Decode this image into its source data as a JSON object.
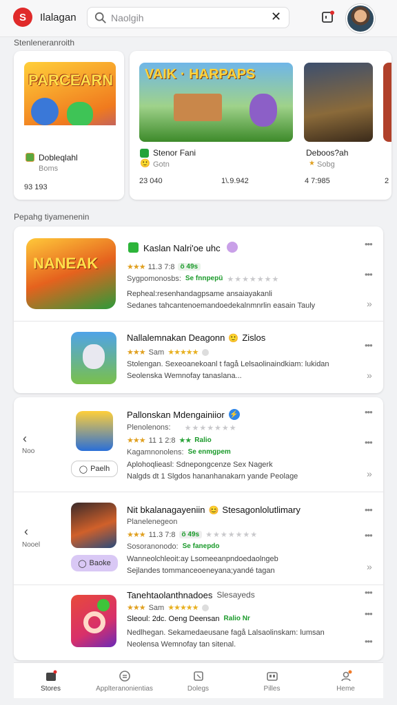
{
  "header": {
    "logo_text": "S",
    "app_name": "Ilalagan",
    "search_placeholder": "Naolgih",
    "accent": "#e02a2a"
  },
  "sections": {
    "featured": "Stenleneranroith",
    "popular": "Pepahg tiyamenenin"
  },
  "featured": [
    {
      "art_text": "PARCEARN",
      "title": "Dobleqlahl",
      "sub": "Boms",
      "count": "93 193"
    },
    {
      "art_text": "VAIK · HARPAPS",
      "title": "Stenor Fani",
      "sub": "Gotn",
      "count": "23 040",
      "count2": "1\\.9.942"
    },
    {
      "art_text": "",
      "title": "Deboos?ah",
      "sub": "Sobg",
      "count": "4 7:985",
      "count2": "2"
    }
  ],
  "list": [
    {
      "art_text": "NANEAK",
      "title": "Kaslan Nalri'oe uhc",
      "rating_text": "11.3 7:8",
      "meta_text": "ö 49s",
      "sub": "Sygpomonosbs:",
      "green": "Se fnnpepü",
      "desc1": "Repheal:resenhandagpsame ansaiayakanli",
      "desc2": "Sedanes tahcantenoemandoedekalnmnrlin easain Tauly"
    },
    {
      "title": "Nallalemnakan Deagonn",
      "emoji": "🙂",
      "title_suffix": "Zislos",
      "rating_text": "Sam",
      "sub": "Stolengan. Sexeoanekoanl t fagå Lelsaolinaindkiam: lukidan",
      "desc2": "Seolenska Wemnofay tanaslana..."
    },
    {
      "title": "Pallonskan Mdengainiior",
      "sub": "Plenolenons:",
      "rating_text": "11 1 2:8",
      "green_small": "Ralio",
      "green": "Se enmgpem",
      "sub2": "Kagamnonolens:",
      "desc1": "Aplohoqlieasl: Sdnepongcenze Sex Nagerk",
      "desc2": "Nalgds dt 1 Slgdos hananhanakarn yande Peolage",
      "btn": "Paelh",
      "side_label": "Noo"
    },
    {
      "title": "Nit bkalanagayeniin",
      "emoji": "😊",
      "title_suffix": "Stesagonlolutlimary",
      "sub": "Planelenegeon",
      "rating_text": "11.3 7:8",
      "meta_text": "ö 49s",
      "sub2": "Sosoranonodo:",
      "green": "Se fanepdo",
      "desc1": "Wanneolchleoit:ay Lsomeeanpndoedaolngeb",
      "desc2": "Sejlandes tommanceoeneyana;yandé tagan",
      "btn": "Baoke",
      "side_label": "Nooel"
    },
    {
      "title": "Tanehtaolanthnadoes",
      "title_suffix": "Slesayeds",
      "rating_text": "Sam",
      "sub": "Sleoul: 2dc. Oeng Deensan",
      "green": "Ralio Nr",
      "desc1": "Nedlhegan. Sekamedaeusane fagå Lalsaolinskam: lumsan",
      "desc2": "Neolensa Wemnofay tan sitenal."
    }
  ],
  "nav": [
    {
      "label": "Stores",
      "icon": "store-icon",
      "active": true
    },
    {
      "label": "Applteranonientias",
      "icon": "apps-icon"
    },
    {
      "label": "Dolegs",
      "icon": "games-icon"
    },
    {
      "label": "Pilles",
      "icon": "books-icon"
    },
    {
      "label": "Heme",
      "icon": "profile-icon"
    }
  ]
}
